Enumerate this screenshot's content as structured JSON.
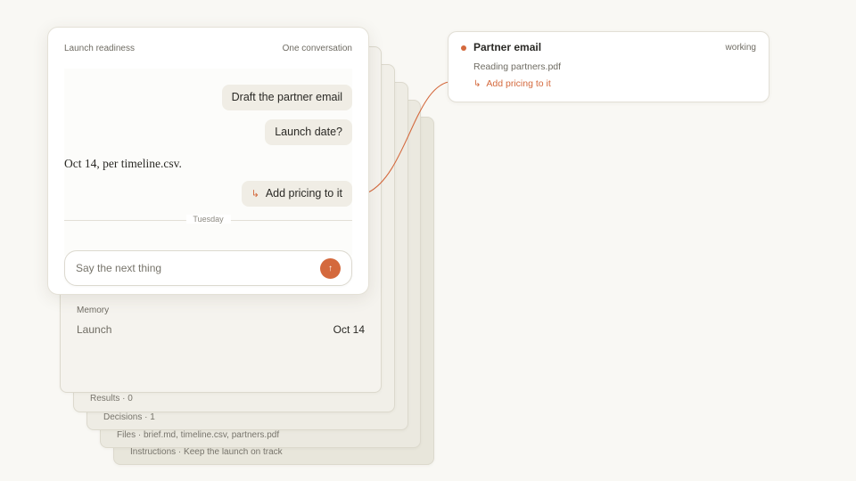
{
  "conversation": {
    "title": "Launch readiness",
    "scope": "One conversation",
    "messages": [
      {
        "role": "user",
        "text": "Draft the partner email"
      },
      {
        "role": "user",
        "text": "Launch date?"
      },
      {
        "role": "assistant",
        "text": "Oct 14, per timeline.csv."
      },
      {
        "role": "user",
        "text": "Add pricing to it",
        "icon": "reply-arrow-icon"
      }
    ],
    "divider_label": "Tuesday",
    "composer": {
      "placeholder": "Say the next thing",
      "value": "",
      "send_icon": "arrow-up-icon"
    }
  },
  "layers": {
    "memory": {
      "title": "Memory",
      "rows": [
        {
          "key": "Launch",
          "value": "Oct 14"
        }
      ]
    },
    "results": "Results · 0",
    "decisions": "Decisions · 1",
    "files": "Files · brief.md, timeline.csv, partners.pdf",
    "instructions": "Instructions · Keep the launch on track"
  },
  "task": {
    "title": "Partner email",
    "status": "working",
    "detail": "Reading partners.pdf",
    "subtask": "Add pricing to it",
    "subtask_icon": "reply-arrow-icon"
  },
  "colors": {
    "accent": "#d4693d",
    "background": "#f9f8f4",
    "bubble": "#f0ede5"
  }
}
